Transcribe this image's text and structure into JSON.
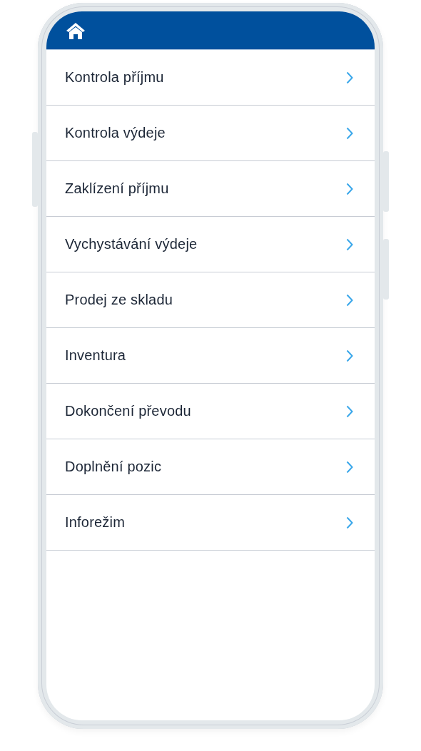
{
  "menu": [
    {
      "label": "Kontrola příjmu"
    },
    {
      "label": "Kontrola výdeje"
    },
    {
      "label": "Zaklízení příjmu"
    },
    {
      "label": "Vychystávání výdeje"
    },
    {
      "label": "Prodej ze skladu"
    },
    {
      "label": "Inventura"
    },
    {
      "label": "Dokončení převodu"
    },
    {
      "label": "Doplnění pozic"
    },
    {
      "label": "Inforežim"
    }
  ]
}
